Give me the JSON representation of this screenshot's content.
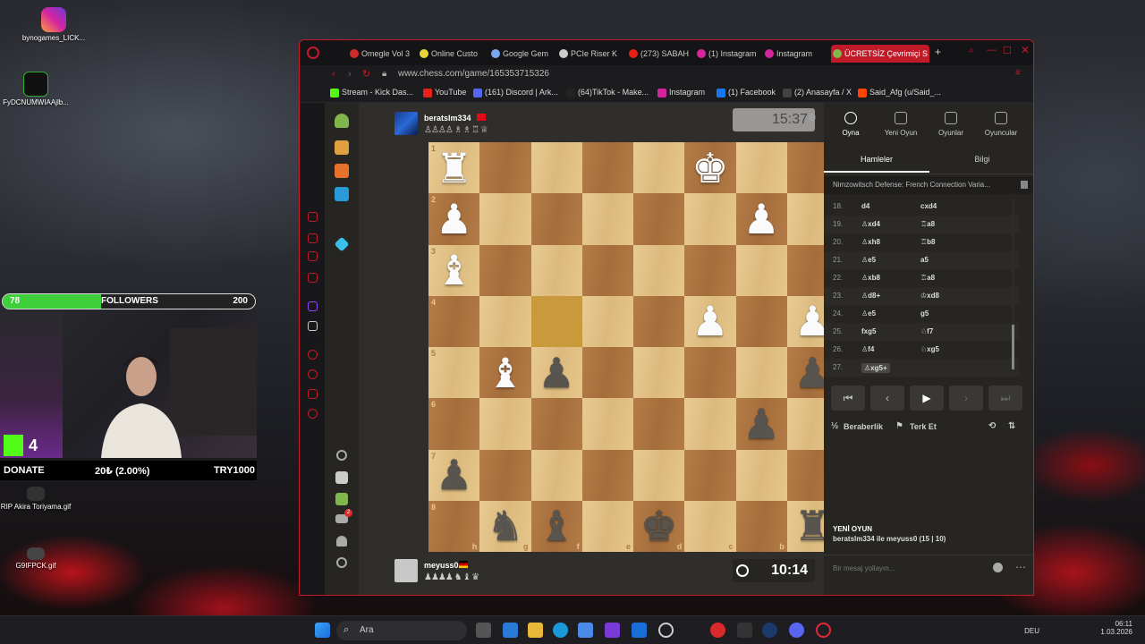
{
  "desktop": {
    "icons": [
      {
        "label": "bynogames_LICK..."
      },
      {
        "label": "FyDCNUMWIAAjlb..."
      },
      {
        "label": "RIP Akira Toriyama.gif"
      },
      {
        "label": "G9IFPCK.gif"
      }
    ]
  },
  "overlay": {
    "followers_current": "78",
    "followers_label": "FOLLOWERS",
    "followers_goal": "200",
    "followers_fraction": 0.39,
    "kick_count": "4",
    "donate_label": "DONATE",
    "donate_amount": "20₺ (2.00%)",
    "donate_goal": "TRY1000"
  },
  "browser": {
    "tabs": [
      {
        "label": "Omegle Vol 3",
        "color": "#d12a2a"
      },
      {
        "label": "Online Custo",
        "color": "#e8d63a"
      },
      {
        "label": "Google Gem",
        "color": "#7aa7f0"
      },
      {
        "label": "PCIe Riser K",
        "color": "#cccccc"
      },
      {
        "label": "(273) SABAH",
        "color": "#e62117"
      },
      {
        "label": "(1) Instagram",
        "color": "#d6249f"
      },
      {
        "label": "Instagram",
        "color": "#d6249f"
      },
      {
        "label": "ÜCRETSİZ Çevrimiçi S",
        "color": "#81b64c"
      }
    ],
    "url": "www.chess.com/game/165353715326",
    "bookmarks": [
      {
        "label": "Stream - Kick Das...",
        "color": "#53fc18"
      },
      {
        "label": "YouTube",
        "color": "#e62117"
      },
      {
        "label": "(161) Discord | Ark...",
        "color": "#5865f2"
      },
      {
        "label": "(64)TikTok - Make...",
        "color": "#222222"
      },
      {
        "label": "Instagram",
        "color": "#d6249f"
      },
      {
        "label": "(1) Facebook",
        "color": "#1877f2"
      },
      {
        "label": "(2) Anasayfa / X",
        "color": "#444444"
      },
      {
        "label": "Said_Afg (u/Said_...",
        "color": "#ff4500"
      }
    ]
  },
  "game": {
    "top_player": {
      "name": "beratslm334",
      "captures": "♙♙♙♙ ♗ ♗ ♖ ♕"
    },
    "bottom_player": {
      "name": "meyuss0",
      "captures": "♟♟♟♟ ♞ ♝ ♛"
    },
    "top_clock": "15:37",
    "bottom_clock": "10:14",
    "accent": "#81b64c",
    "board": {
      "ranks": [
        "1",
        "2",
        "3",
        "4",
        "5",
        "6",
        "7",
        "8"
      ],
      "files": [
        "h",
        "g",
        "f",
        "e",
        "d",
        "c",
        "b",
        "a"
      ],
      "rows": [
        [
          "wR",
          "",
          "",
          "",
          "",
          "wK",
          "",
          ""
        ],
        [
          "wP",
          "",
          "",
          "",
          "",
          "",
          "wP",
          ""
        ],
        [
          "wB",
          "",
          "",
          "",
          "",
          "",
          "",
          ""
        ],
        [
          "",
          "",
          "",
          "",
          "",
          "wP",
          "",
          "wP"
        ],
        [
          "",
          "wB",
          "bP",
          "",
          "",
          "",
          "",
          "bP"
        ],
        [
          "",
          "",
          "",
          "",
          "",
          "",
          "bP",
          ""
        ],
        [
          "bP",
          "",
          "",
          "",
          "",
          "",
          "",
          ""
        ],
        [
          "",
          "bN",
          "bB",
          "",
          "bK",
          "",
          "",
          "bR"
        ]
      ],
      "highlight": [
        "3-2"
      ]
    }
  },
  "panel": {
    "tabs": [
      {
        "label": "Oyna"
      },
      {
        "label": "Yeni Oyun"
      },
      {
        "label": "Oyunlar"
      },
      {
        "label": "Oyuncular"
      }
    ],
    "subtabs": [
      {
        "label": "Hamleler"
      },
      {
        "label": "Bilgi"
      }
    ],
    "opening": "Nimzowitsch Defense: French Connection Varia...",
    "moves": [
      {
        "n": "18.",
        "w": "d4",
        "b": "cxd4"
      },
      {
        "n": "19.",
        "w": "♙xd4",
        "b": "♖a8"
      },
      {
        "n": "20.",
        "w": "♙xh8",
        "b": "♖b8"
      },
      {
        "n": "21.",
        "w": "♙e5",
        "b": "a5"
      },
      {
        "n": "22.",
        "w": "♙xb8",
        "b": "♖a8"
      },
      {
        "n": "23.",
        "w": "♙d8+",
        "b": "♔xd8"
      },
      {
        "n": "24.",
        "w": "♙e5",
        "b": "g5"
      },
      {
        "n": "25.",
        "w": "fxg5",
        "b": "♘f7"
      },
      {
        "n": "26.",
        "w": "♙f4",
        "b": "♘xg5"
      },
      {
        "n": "27.",
        "w": "♙xg5+",
        "b": ""
      }
    ],
    "actions": {
      "draw": "Beraberlik",
      "resign": "Terk Et"
    },
    "new_game_title": "YENİ OYUN",
    "new_game_text": "beratslm334 ile meyuss0 (15 | 10)",
    "chat_placeholder": "Bir mesaj yollayın..."
  },
  "taskbar": {
    "search": "Ara",
    "lang": "DEU",
    "time": "06:11",
    "date": "1.03.2026"
  }
}
